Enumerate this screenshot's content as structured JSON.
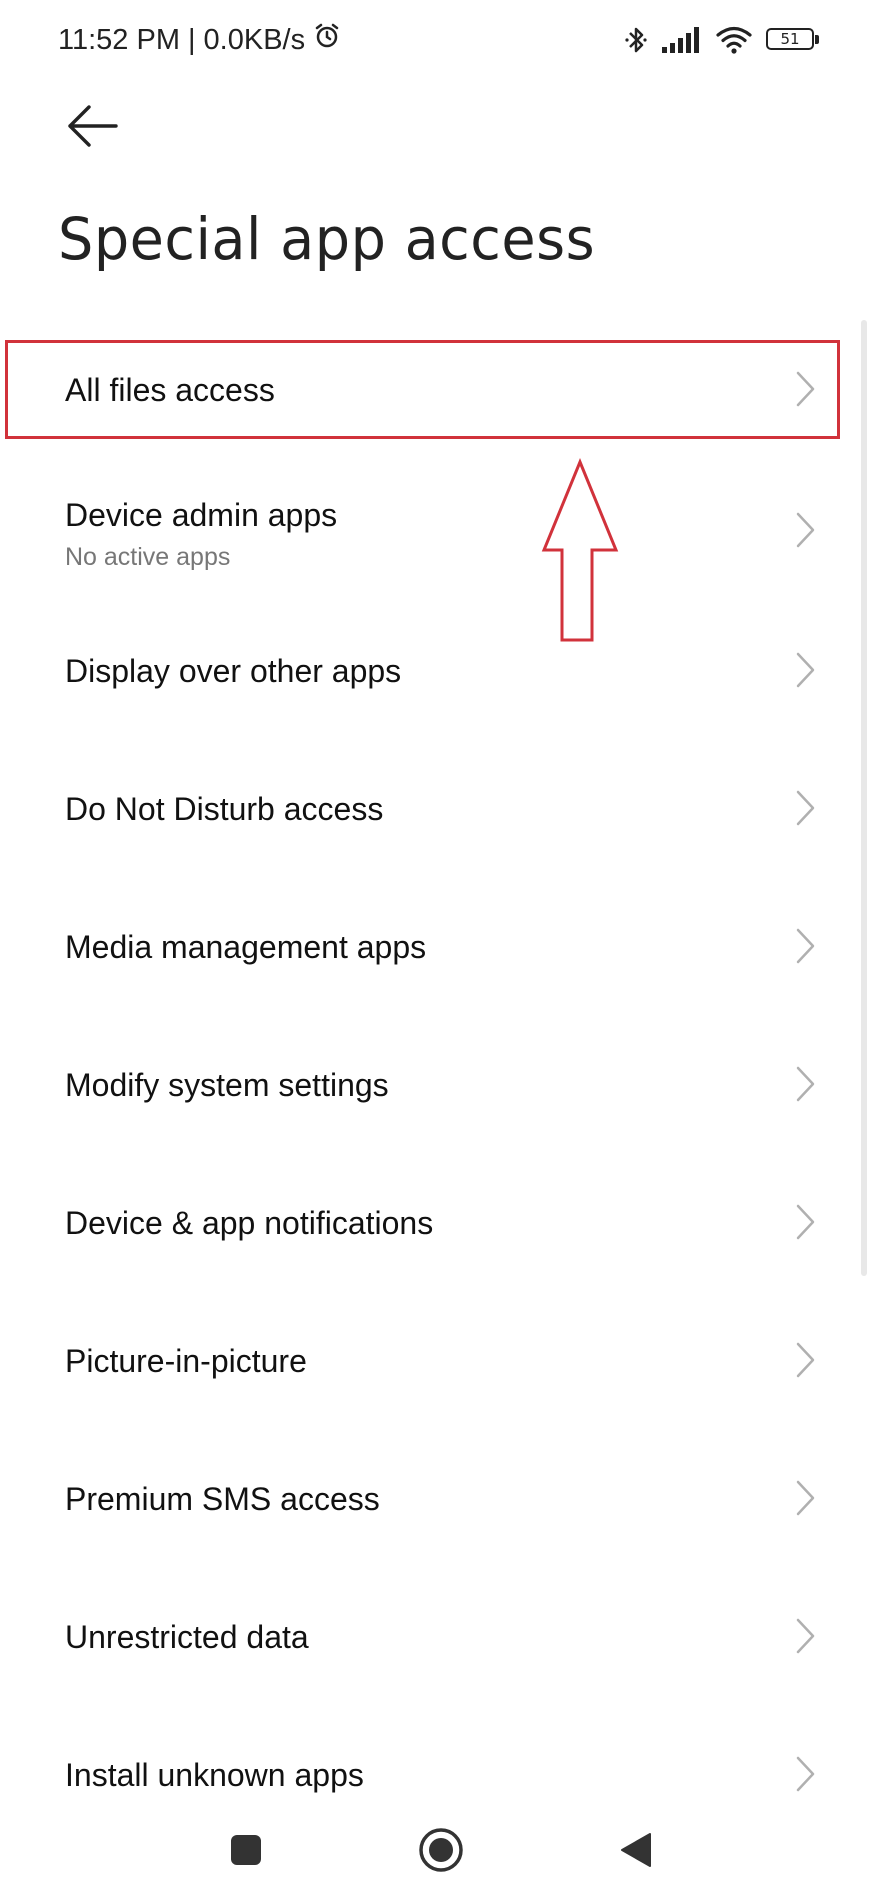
{
  "status_bar": {
    "time": "11:52 PM",
    "separator": "|",
    "net_speed": "0.0KB/s",
    "battery_level": "51",
    "icons": [
      "alarm-icon",
      "bluetooth-icon",
      "signal-icon",
      "wifi-icon",
      "battery-icon"
    ]
  },
  "header": {
    "back_icon": "back-arrow-icon",
    "title": "Special app access"
  },
  "items": [
    {
      "label": "All files access",
      "subtitle": ""
    },
    {
      "label": "Device admin apps",
      "subtitle": "No active apps"
    },
    {
      "label": "Display over other apps",
      "subtitle": ""
    },
    {
      "label": "Do Not Disturb access",
      "subtitle": ""
    },
    {
      "label": "Media management apps",
      "subtitle": ""
    },
    {
      "label": "Modify system settings",
      "subtitle": ""
    },
    {
      "label": "Device & app notifications",
      "subtitle": ""
    },
    {
      "label": "Picture-in-picture",
      "subtitle": ""
    },
    {
      "label": "Premium SMS access",
      "subtitle": ""
    },
    {
      "label": "Unrestricted data",
      "subtitle": ""
    },
    {
      "label": "Install unknown apps",
      "subtitle": ""
    }
  ],
  "annotation": {
    "highlight_color": "#d1323b",
    "highlighted_item": "All files access"
  },
  "nav_bar": {
    "icons": [
      "recents-square-icon",
      "home-circle-icon",
      "back-triangle-icon"
    ]
  }
}
